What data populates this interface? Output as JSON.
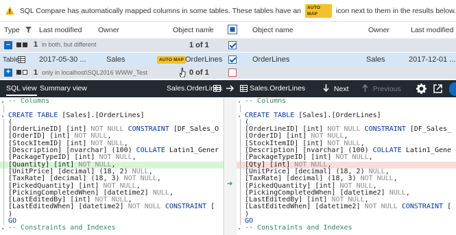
{
  "notification": {
    "text_before": "SQL Compare has automatically mapped columns in some tables. These tables have an",
    "badge": "AUTO MAP",
    "text_after": "icon next to them in the results below."
  },
  "grid": {
    "headers": {
      "type": "Type",
      "last_modified": "Last modified",
      "owner": "Owner",
      "object_name": "Object name",
      "object_name_right": "Object name",
      "owner_right": "Owner",
      "last_modified_right": "Last modified"
    },
    "group1": {
      "count": "1",
      "label": "in both, but different",
      "ratio": "1 of 1"
    },
    "row": {
      "type": "Table",
      "last_modified": "2017-05-30 ...",
      "owner": "Sales",
      "badge": "AUTO MAP",
      "object_name": "OrderLines",
      "object_name_right": "OrderLines",
      "owner_right": "Sales",
      "last_modified_right": "2017-12-01 ..."
    },
    "group2": {
      "count": "1",
      "label": "only in localhost\\SQL2016 WWW_Test",
      "ratio": "0 of 1"
    }
  },
  "toolbar": {
    "tab_sql": "SQL view",
    "tab_summary": "Summary view",
    "left_object": "Sales.OrderLines",
    "right_object": "Sales.OrderLines",
    "next": "Next",
    "previous": "Previous"
  },
  "code_left": [
    "-- Columns",
    "",
    "CREATE TABLE [Sales].[OrderLines]",
    "(",
    "[OrderLineID] [int] NOT NULL CONSTRAINT [DF_Sales_O",
    "[OrderID] [int] NOT NULL,",
    "[StockItemID] [int] NOT NULL,",
    "[Description] [nvarchar] (100) COLLATE Latin1_Gener",
    "[PackageTypeID] [int] NOT NULL,",
    "[Quantity] [int] NOT NULL,",
    "[UnitPrice] [decimal] (18, 2) NULL,",
    "[TaxRate] [decimal] (18, 3) NOT NULL,",
    "[PickedQuantity] [int] NOT NULL,",
    "[PickingCompletedWhen] [datetime2] NULL,",
    "[LastEditedBy] [int] NOT NULL,",
    "[LastEditedWhen] [datetime2] NOT NULL CONSTRAINT [",
    ")",
    "GO",
    "-- Constraints and Indexes"
  ],
  "code_right": [
    "-- Columns",
    "",
    "CREATE TABLE [Sales].[OrderLines]",
    "(",
    "[OrderLineID] [int] NOT NULL CONSTRAINT [DF_Sales_",
    "[OrderID] [int] NOT NULL,",
    "[StockItemID] [int] NOT NULL,",
    "[Description] [nvarchar] (100) COLLATE Latin1_Gene",
    "[PackageTypeID] [int] NOT NULL,",
    "[Qty] [int] NOT NULL,",
    "[UnitPrice] [decimal] (18, 2) NULL,",
    "[TaxRate] [decimal] (18, 3) NOT NULL,",
    "[PickedQuantity] [int] NOT NULL,",
    "[PickingCompletedWhen] [datetime2] NULL,",
    "[LastEditedBy] [int] NOT NULL,",
    "[LastEditedWhen] [datetime2] NOT NULL CONSTRAINT [",
    ")",
    "GO",
    "-- Constraints and Indexes"
  ],
  "colors": {
    "toolbar_bg": "#222930",
    "accent": "#0f6cbd",
    "added_line": "#d7f5d5",
    "removed_line": "#fadcdc",
    "automap_badge": "#f2c22a"
  },
  "icons": [
    "warning-icon",
    "funnel-icon",
    "table-icon",
    "arrow-right-icon",
    "arrow-down-icon",
    "arrow-up-icon",
    "gear-icon",
    "external-link-icon",
    "checkbox-icon",
    "mouse-cursor-icon"
  ]
}
